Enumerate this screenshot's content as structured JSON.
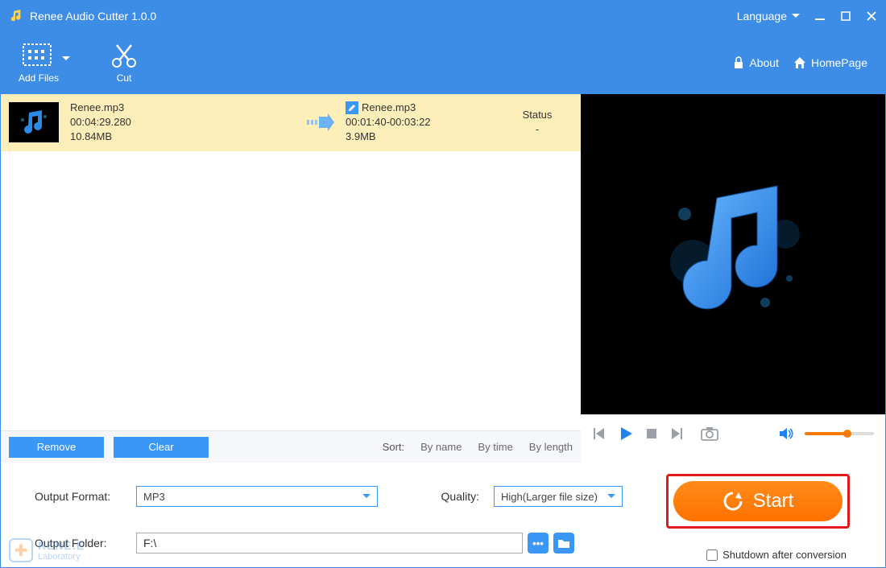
{
  "titlebar": {
    "title": "Renee Audio Cutter 1.0.0",
    "language": "Language"
  },
  "toolbar": {
    "add_files": "Add Files",
    "cut": "Cut",
    "about": "About",
    "homepage": "HomePage"
  },
  "file": {
    "src_name": "Renee.mp3",
    "src_duration": "00:04:29.280",
    "src_size": "10.84MB",
    "dst_name": "Renee.mp3",
    "dst_range": "00:01:40-00:03:22",
    "dst_size": "3.9MB",
    "status_header": "Status",
    "status_value": "-"
  },
  "actions": {
    "remove": "Remove",
    "clear": "Clear",
    "sort_label": "Sort:",
    "by_name": "By name",
    "by_time": "By time",
    "by_length": "By length"
  },
  "output": {
    "format_label": "Output Format:",
    "format_value": "MP3",
    "quality_label": "Quality:",
    "quality_value": "High(Larger file size)",
    "folder_label": "Output Folder:",
    "folder_value": "F:\\"
  },
  "start": {
    "label": "Start",
    "shutdown": "Shutdown after conversion"
  },
  "watermark": {
    "brand": "RENE.E",
    "sub": "Laboratory"
  }
}
